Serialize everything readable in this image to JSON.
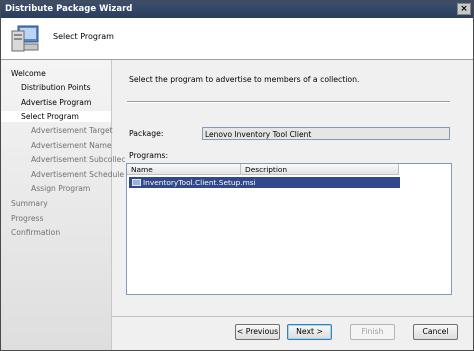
{
  "window": {
    "title": "Distribute Package Wizard",
    "close_glyph": "×"
  },
  "header": {
    "page_title": "Select Program",
    "icon": "computer-wizard-icon"
  },
  "nav": {
    "items": [
      {
        "label": "Welcome",
        "state": "normal"
      },
      {
        "label": "Distribution Points",
        "state": "normal"
      },
      {
        "label": "Advertise Program",
        "state": "normal"
      },
      {
        "label": "Select Program",
        "state": "active"
      },
      {
        "label": "Advertisement Target",
        "state": "muted"
      },
      {
        "label": "Advertisement Name",
        "state": "muted"
      },
      {
        "label": "Advertisement Subcollec",
        "state": "muted"
      },
      {
        "label": "Advertisement Schedule",
        "state": "muted"
      },
      {
        "label": "Assign Program",
        "state": "muted"
      },
      {
        "label": "Summary",
        "state": "muted"
      },
      {
        "label": "Progress",
        "state": "muted"
      },
      {
        "label": "Confirmation",
        "state": "muted"
      }
    ]
  },
  "main": {
    "instruction": "Select the program to advertise to members of a collection.",
    "package_label": "Package:",
    "package_value": "Lenovo Inventory Tool Client",
    "programs_label": "Programs:",
    "columns": [
      "Name",
      "Description"
    ],
    "rows": [
      {
        "name": "InventoryTool.Client.Setup.msi",
        "description": "",
        "selected": true
      }
    ]
  },
  "buttons": {
    "previous": "< Previous",
    "next": "Next >",
    "finish": "Finish",
    "cancel": "Cancel"
  }
}
